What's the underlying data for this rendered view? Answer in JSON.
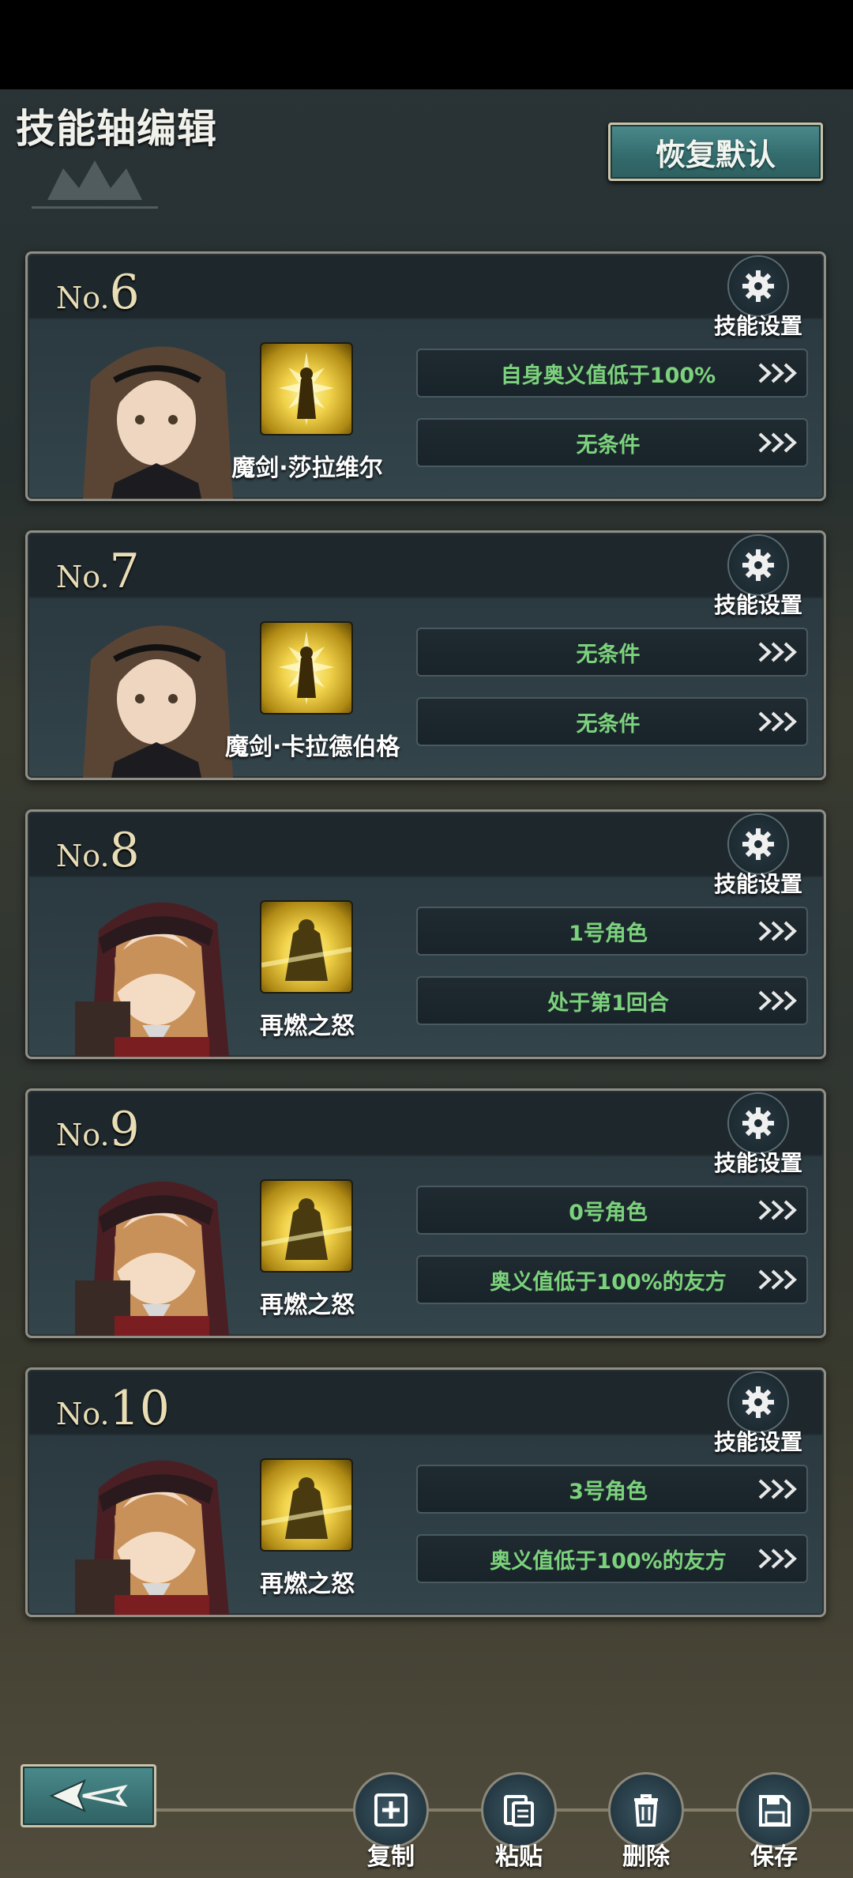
{
  "header": {
    "title": "技能轴编辑",
    "reset_label": "恢复默认"
  },
  "settings_label": "技能设置",
  "cards": [
    {
      "prefix": "No.",
      "num": "6",
      "skill": "魔剑·莎拉维尔",
      "cond1": "自身奥义值低于100%",
      "cond2": "无条件"
    },
    {
      "prefix": "No.",
      "num": "7",
      "skill": "魔剑·卡拉德伯格",
      "cond1": "无条件",
      "cond2": "无条件"
    },
    {
      "prefix": "No.",
      "num": "8",
      "skill": "再燃之怒",
      "cond1": "1号角色",
      "cond2": "处于第1回合"
    },
    {
      "prefix": "No.",
      "num": "9",
      "skill": "再燃之怒",
      "cond1": "0号角色",
      "cond2": "奥义值低于100%的友方"
    },
    {
      "prefix": "No.",
      "num": "10",
      "skill": "再燃之怒",
      "cond1": "3号角色",
      "cond2": "奥义值低于100%的友方"
    }
  ],
  "toolbar": {
    "copy": "复制",
    "paste": "粘贴",
    "delete": "删除",
    "save": "保存"
  },
  "colors": {
    "condition_text": "#7cd27c",
    "accent_teal": "#3f7c7e",
    "number_gold": "#e9ddb6"
  }
}
